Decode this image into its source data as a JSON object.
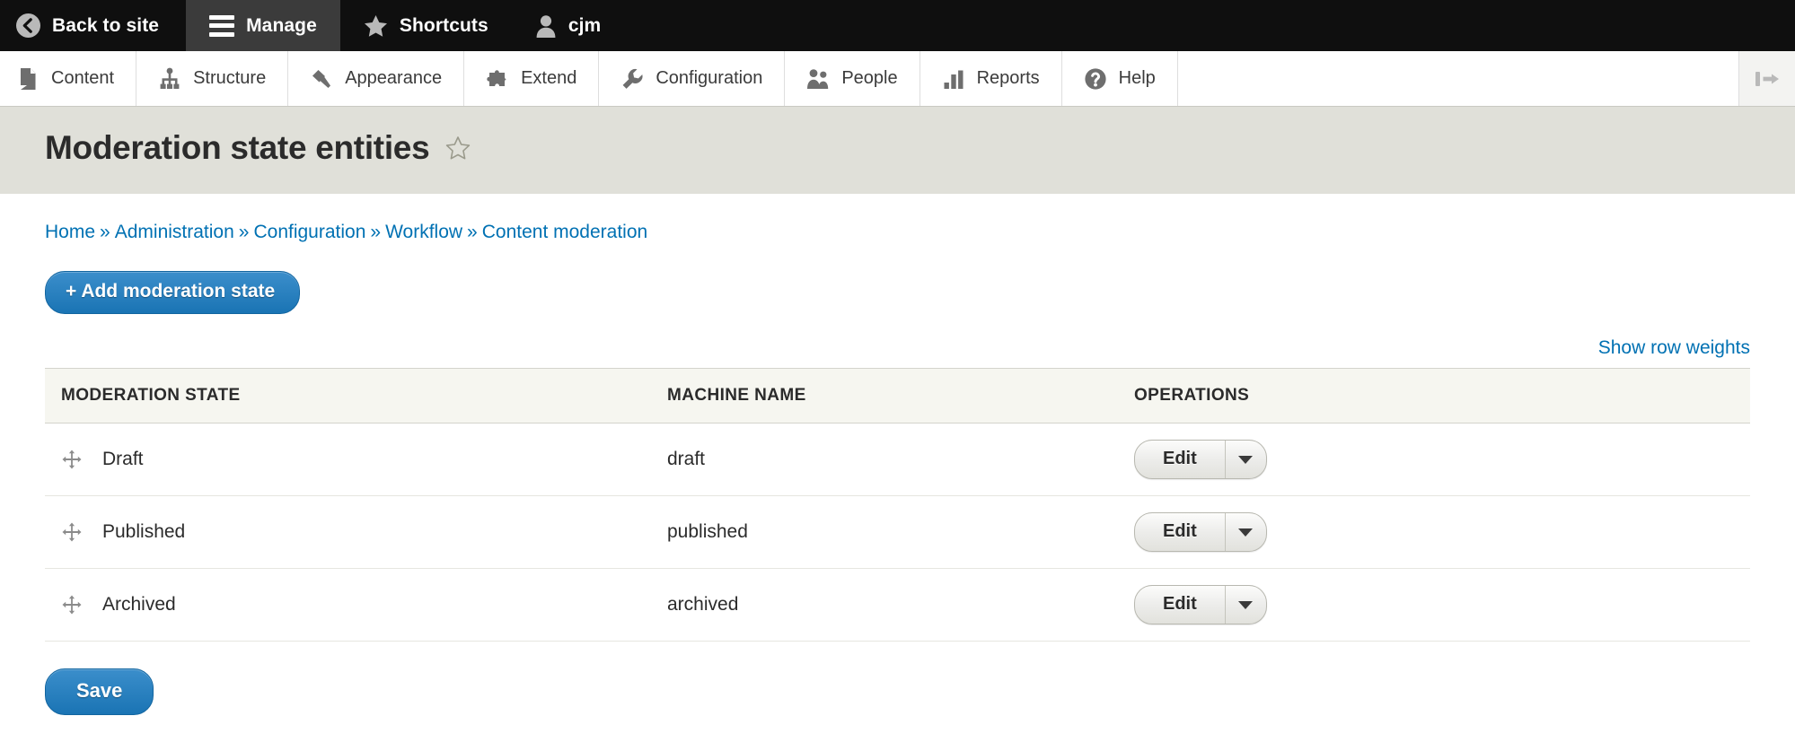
{
  "toolbar": {
    "items": [
      {
        "label": "Back to site",
        "icon": "back-arrow-circle-icon",
        "active": false
      },
      {
        "label": "Manage",
        "icon": "hamburger-menu-icon",
        "active": true
      },
      {
        "label": "Shortcuts",
        "icon": "star-icon",
        "active": false
      },
      {
        "label": "cjm",
        "icon": "user-account-icon",
        "active": false
      }
    ]
  },
  "menu_tray": {
    "items": [
      {
        "label": "Content",
        "icon": "document-icon"
      },
      {
        "label": "Structure",
        "icon": "structure-tree-icon"
      },
      {
        "label": "Appearance",
        "icon": "paintbrush-icon"
      },
      {
        "label": "Extend",
        "icon": "puzzle-piece-icon"
      },
      {
        "label": "Configuration",
        "icon": "wrench-icon"
      },
      {
        "label": "People",
        "icon": "people-icon"
      },
      {
        "label": "Reports",
        "icon": "bar-chart-icon"
      },
      {
        "label": "Help",
        "icon": "question-mark-circle-icon"
      }
    ],
    "collapse_icon": "collapse-toolbar-icon"
  },
  "page": {
    "title": "Moderation state entities",
    "favorite_icon": "star-outline-icon"
  },
  "breadcrumb": {
    "separator": "»",
    "items": [
      {
        "label": "Home"
      },
      {
        "label": "Administration"
      },
      {
        "label": "Configuration"
      },
      {
        "label": "Workflow"
      },
      {
        "label": "Content moderation"
      }
    ]
  },
  "actions": {
    "add_label": "+ Add moderation state"
  },
  "table_controls": {
    "show_row_weights": "Show row weights"
  },
  "table": {
    "columns": [
      "MODERATION STATE",
      "MACHINE NAME",
      "OPERATIONS"
    ],
    "rows": [
      {
        "state": "Draft",
        "machine_name": "draft",
        "operation": "Edit",
        "drag_icon": "drag-handle-icon",
        "caret_icon": "chevron-down-icon"
      },
      {
        "state": "Published",
        "machine_name": "published",
        "operation": "Edit",
        "drag_icon": "drag-handle-icon",
        "caret_icon": "chevron-down-icon"
      },
      {
        "state": "Archived",
        "machine_name": "archived",
        "operation": "Edit",
        "drag_icon": "drag-handle-icon",
        "caret_icon": "chevron-down-icon"
      }
    ]
  },
  "form": {
    "save_label": "Save"
  },
  "colors": {
    "toolbar_bg": "#0f0f0f",
    "toolbar_active_bg": "#3b3b3b",
    "title_band_bg": "#e0e0d9",
    "link_blue": "#0071b3",
    "button_blue": "#1a74b4",
    "table_header_bg": "#f6f6f0"
  }
}
